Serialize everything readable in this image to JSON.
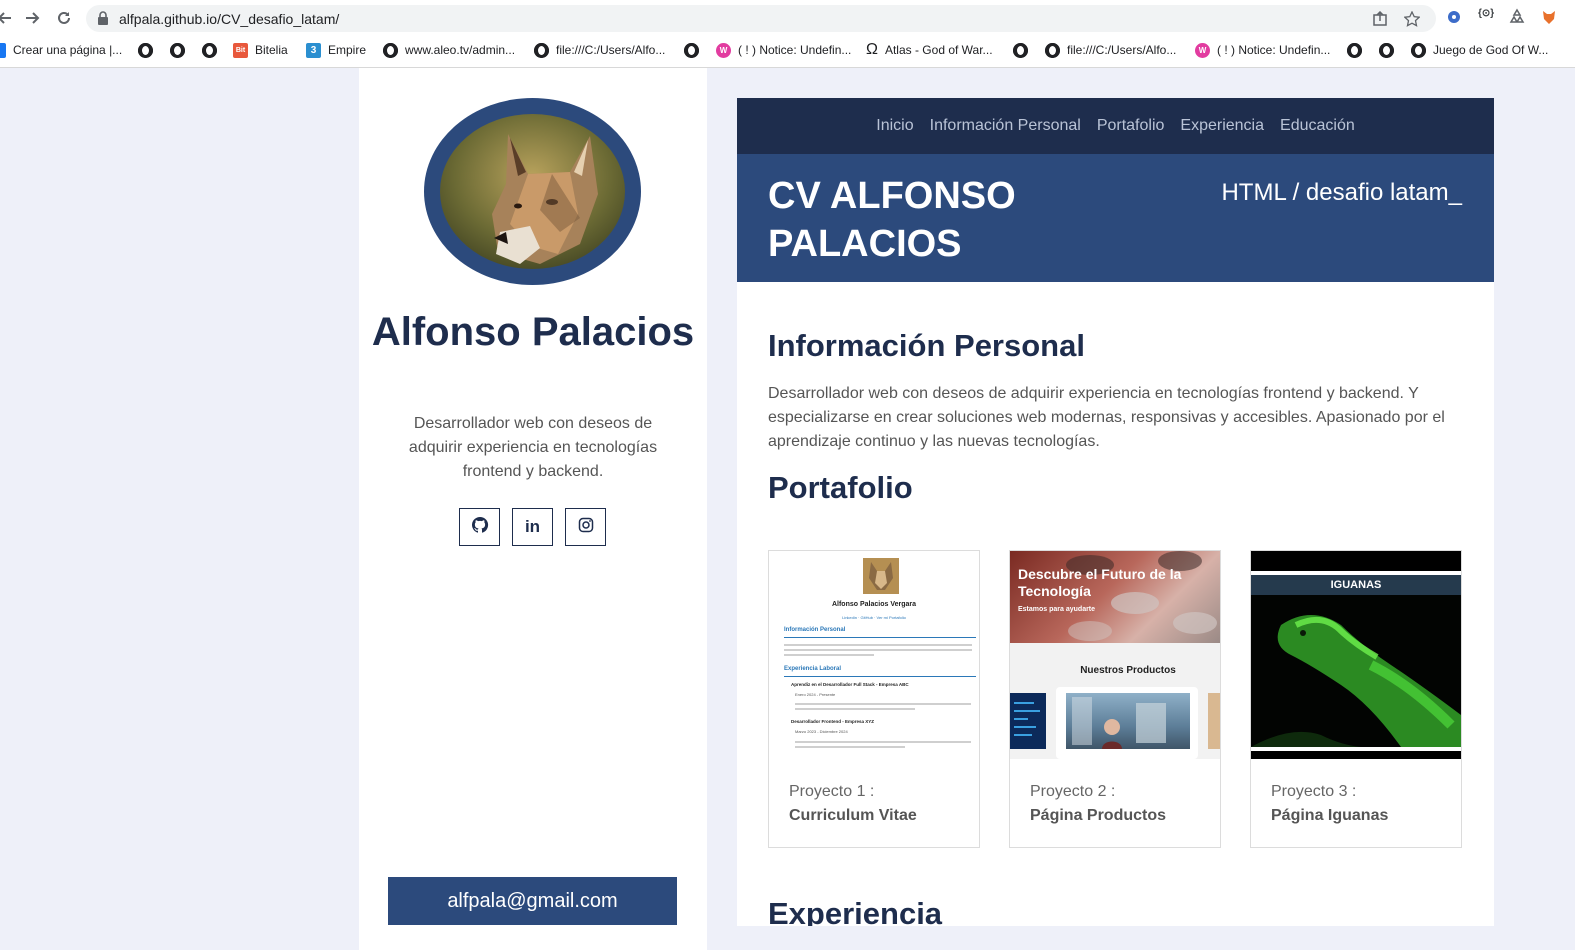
{
  "browser": {
    "url": "alfpala.github.io/CV_desafio_latam/",
    "bookmarks": [
      {
        "label": "Crear una página |...",
        "icon": "facebook-icon"
      },
      {
        "label": "",
        "icon": "globe-icon"
      },
      {
        "label": "",
        "icon": "globe-icon"
      },
      {
        "label": "",
        "icon": "globe-icon"
      },
      {
        "label": "Bitelia",
        "icon": "bitelia-icon"
      },
      {
        "label": "Empire",
        "icon": "empire-icon"
      },
      {
        "label": "www.aleo.tv/admin...",
        "icon": "globe-icon"
      },
      {
        "label": "file:///C:/Users/Alfo...",
        "icon": "globe-icon"
      },
      {
        "label": "",
        "icon": "globe-icon"
      },
      {
        "label": "( ! ) Notice: Undefin...",
        "icon": "wamp-icon"
      },
      {
        "label": "Atlas - God of War...",
        "icon": "omega-icon"
      },
      {
        "label": "",
        "icon": "globe-icon"
      },
      {
        "label": "file:///C:/Users/Alfo...",
        "icon": "globe-icon"
      },
      {
        "label": "( ! ) Notice: Undefin...",
        "icon": "wamp-icon"
      },
      {
        "label": "",
        "icon": "globe-icon"
      },
      {
        "label": "",
        "icon": "globe-icon"
      },
      {
        "label": "Juego de God Of W...",
        "icon": "globe-icon"
      }
    ]
  },
  "sidebar": {
    "name": "Alfonso Palacios",
    "description": "Desarrollador web con deseos de adquirir experiencia en tecnologías frontend y backend.",
    "socials": [
      "github-icon",
      "linkedin-icon",
      "instagram-icon"
    ],
    "email": "alfpala@gmail.com"
  },
  "nav": [
    "Inicio",
    "Información Personal",
    "Portafolio",
    "Experiencia",
    "Educación"
  ],
  "hero": {
    "title": "CV ALFONSO PALACIOS",
    "subtitle": "HTML / desafio latam_"
  },
  "info": {
    "heading": "Información Personal",
    "text": "Desarrollador web con deseos de adquirir experiencia en tecnologías frontend y backend. Y especializarse en crear soluciones web modernas, responsivas y accesibles. Apasionado por el aprendizaje continuo y las nuevas tecnologías."
  },
  "portfolio": {
    "heading": "Portafolio",
    "projects": [
      {
        "label": "Proyecto 1 :",
        "title": "Curriculum Vitae",
        "thumb": {
          "name": "Alfonso Palacios Vergara",
          "links": "Linkedin · GitHub · Ver mi Portafolio",
          "section1": "Información Personal",
          "section2": "Experiencia Laboral",
          "job1": "Aprendiz en el Desarrollador Full Stack - Empresa ABC",
          "job1_date": "Enero 2024 - Presente",
          "job2": "Desarrollador Frontend - Empresa XYZ",
          "job2_date": "Marzo 2023 - Diciembre 2024"
        }
      },
      {
        "label": "Proyecto 2 :",
        "title": "Página Productos",
        "thumb": {
          "headline": "Descubre el Futuro de la Tecnología",
          "tagline": "Estamos para ayudarte",
          "section": "Nuestros Productos"
        }
      },
      {
        "label": "Proyecto 3 :",
        "title": "Página Iguanas",
        "thumb": {
          "header": "IGUANAS"
        }
      }
    ]
  },
  "experience": {
    "heading": "Experiencia"
  },
  "colors": {
    "navy": "#1e2d4d",
    "blue": "#2c4a7c",
    "background": "#eef0f9"
  }
}
